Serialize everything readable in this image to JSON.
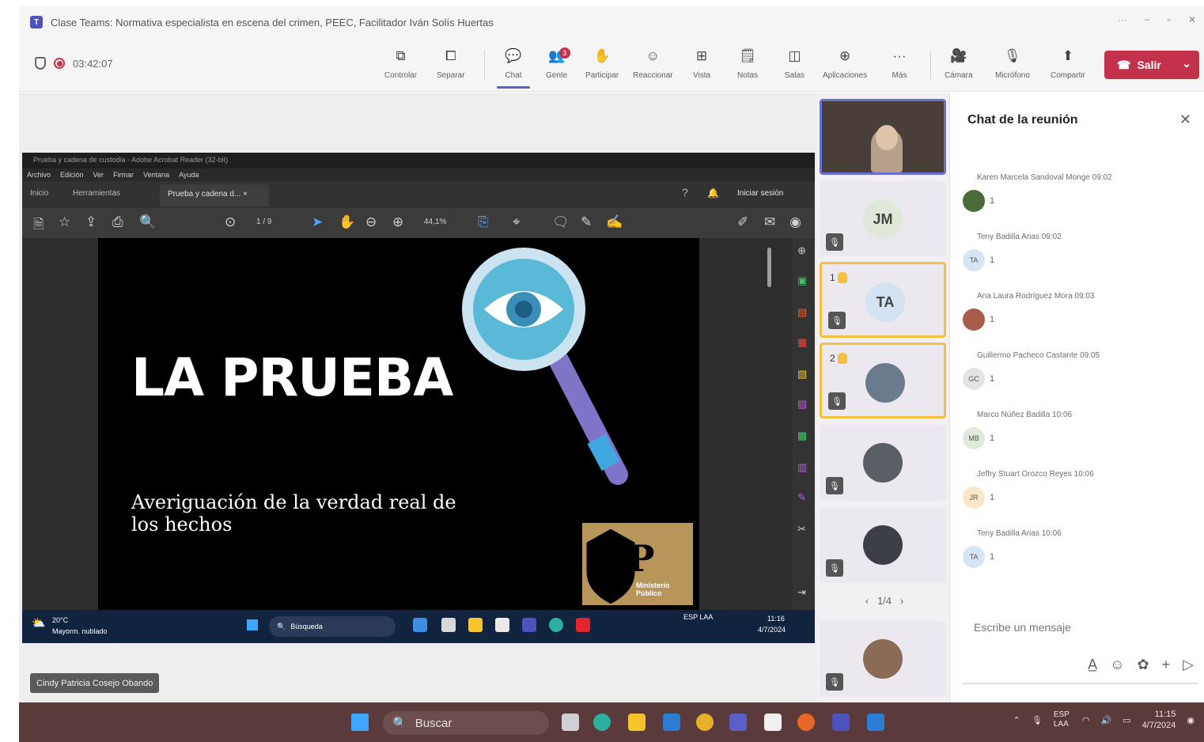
{
  "window": {
    "title": "Clase Teams: Normativa especialista en escena del crimen, PEEC, Facilitador Iván Solís Huertas",
    "controls": [
      "···",
      "−",
      "▫",
      "✕"
    ]
  },
  "meeting": {
    "timer": "03:42:07",
    "toolbar": [
      {
        "label": "Controlar",
        "icon": "control-icon"
      },
      {
        "label": "Separar",
        "icon": "pop-out-icon"
      },
      {
        "label": "Chat",
        "icon": "chat-icon",
        "active": true
      },
      {
        "label": "Gente",
        "icon": "people-icon",
        "badge": "3"
      },
      {
        "label": "Participar",
        "icon": "raise-hand-icon"
      },
      {
        "label": "Reaccionar",
        "icon": "react-icon"
      },
      {
        "label": "Vista",
        "icon": "view-icon"
      },
      {
        "label": "Notas",
        "icon": "notes-icon"
      },
      {
        "label": "Salas",
        "icon": "rooms-icon"
      },
      {
        "label": "Aplicaciones",
        "icon": "apps-icon"
      },
      {
        "label": "Más",
        "icon": "more-icon"
      },
      {
        "label": "Cámara",
        "icon": "camera-icon"
      },
      {
        "label": "Micrófono",
        "icon": "mic-off-icon"
      },
      {
        "label": "Compartir",
        "icon": "share-icon"
      }
    ],
    "leave_label": "Salir",
    "accent": "#5b5fc7",
    "leave_color": "#c4314b"
  },
  "shared_screen": {
    "app_title": "Prueba y cadena de custodia - Adobe Acrobat Reader (32-bit)",
    "menu": [
      "Archivo",
      "Edición",
      "Ver",
      "Firmar",
      "Ventana",
      "Ayuda"
    ],
    "tabs": [
      "Inicio",
      "Herramientas"
    ],
    "active_tab": "Prueba y cadena d... ×",
    "signin": "Iniciar sesión",
    "page_indicator": "1 / 9",
    "zoom": "44,1%",
    "slide": {
      "title": "LA PRUEBA",
      "subtitle": "Averiguación de la verdad real de los hechos",
      "logo_text": "MP",
      "logo_caption": "Ministerio Público"
    },
    "inner_taskbar": {
      "weather_temp": "20°C",
      "weather_desc": "Mayorm. nublado",
      "search": "Búsqueda",
      "lang": "ESP LAA",
      "time": "11:16",
      "date": "4/7/2024"
    }
  },
  "presenter_label": "Cindy Patricia Cosejo Obando",
  "participants": {
    "tiles": [
      {
        "kind": "video-self"
      },
      {
        "kind": "initials",
        "initials": "JM"
      },
      {
        "kind": "initials",
        "initials": "TA",
        "hand": "1"
      },
      {
        "kind": "photo",
        "hand": "2"
      },
      {
        "kind": "photo"
      },
      {
        "kind": "photo"
      },
      {
        "kind": "photo"
      }
    ],
    "pager": "1/4"
  },
  "chat": {
    "title": "Chat de la reunión",
    "messages": [
      {
        "meta": "Karen Marcela Sandoval Monge 09:02",
        "avatar": "",
        "count": "1"
      },
      {
        "meta": "Teny Badilla Arias 09:02",
        "avatar": "TA",
        "count": "1"
      },
      {
        "meta": "Ana Laura Rodríguez Mora 09:03",
        "avatar": "",
        "count": "1"
      },
      {
        "meta": "Guillermo Pacheco Castante 09:05",
        "avatar": "GC",
        "count": "1"
      },
      {
        "meta": "Marco Núñez Badilla 10:06",
        "avatar": "MB",
        "count": "1"
      },
      {
        "meta": "Jeffry Stuart Orozco Reyes 10:06",
        "avatar": "JR",
        "count": "1"
      },
      {
        "meta": "Teny Badilla Arias 10:06",
        "avatar": "TA",
        "count": "1"
      }
    ],
    "compose_placeholder": "Escribe un mensaje"
  },
  "taskbar": {
    "search": "Buscar",
    "lang": "ESP LAA",
    "time": "11:15",
    "date": "4/7/2024"
  }
}
